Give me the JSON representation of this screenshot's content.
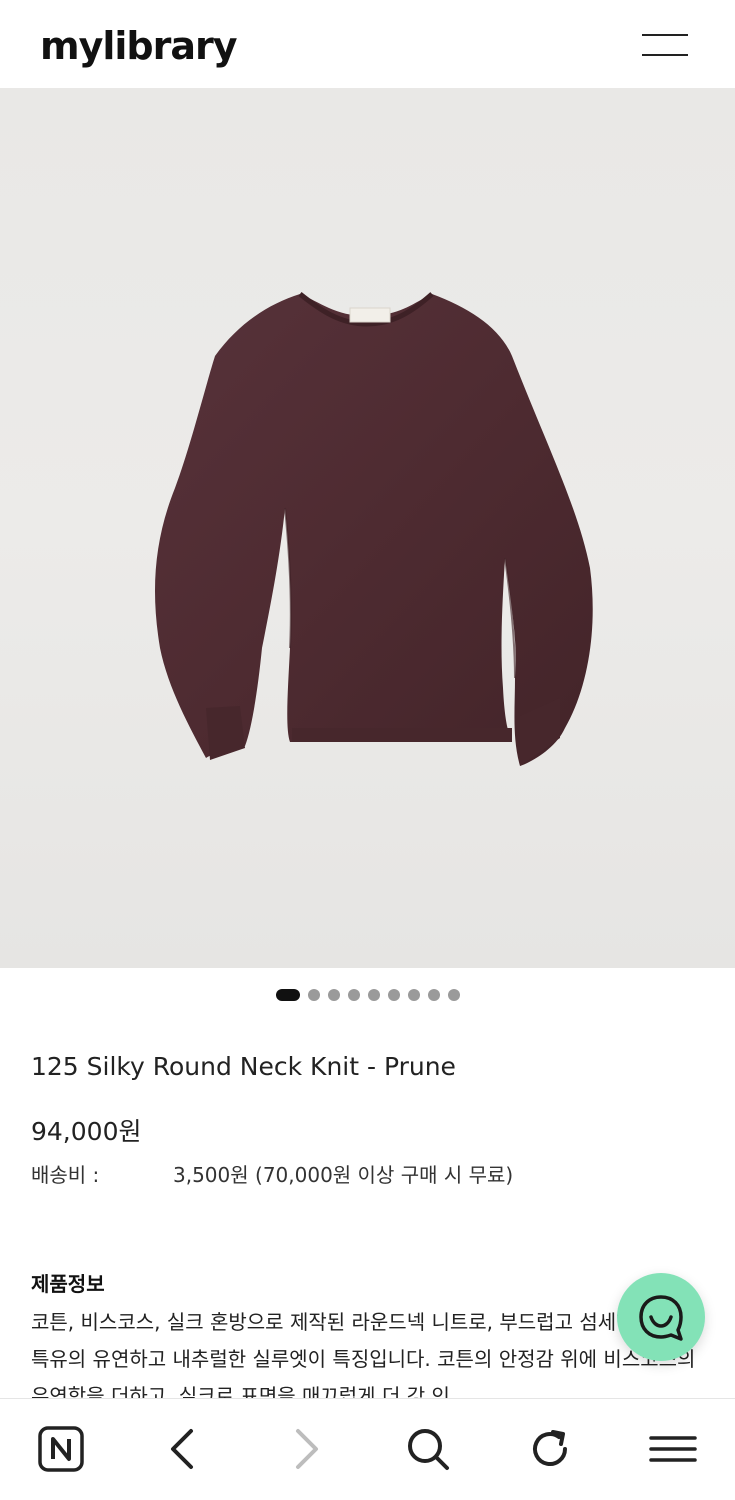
{
  "header": {
    "logo": "mylibrary",
    "menu_icon": "hamburger-menu-icon"
  },
  "gallery": {
    "image_icon": "knit-sweater-image",
    "sweater_color": "#4e2b30",
    "slide_count": 9,
    "active_slide": 1
  },
  "product": {
    "name": "125 Silky Round Neck Knit - Prune",
    "price": "94,000원",
    "shipping_label": "배송비 :",
    "shipping_value": "3,500원 (70,000원 이상 구매 시 무료)"
  },
  "info": {
    "title": "제품정보",
    "body": "코튼, 비스코스, 실크 혼방으로 제작된 라운드넥 니트로, 부드럽고 섬세한 터치와 특유의 유연하고 내추럴한 실루엣이 특징입니다. 코튼의 안정감 위에 비스코스의 유연함을 더하고, 실크로 표면을 매끄럽게 더 강 인"
  },
  "chat": {
    "icon": "chat-bubble-icon",
    "color": "#83e2b7"
  },
  "bottom_nav": {
    "items": [
      {
        "icon": "naver-n-icon"
      },
      {
        "icon": "back-arrow-icon"
      },
      {
        "icon": "forward-arrow-icon"
      },
      {
        "icon": "search-icon"
      },
      {
        "icon": "refresh-icon"
      },
      {
        "icon": "menu-icon"
      }
    ]
  }
}
